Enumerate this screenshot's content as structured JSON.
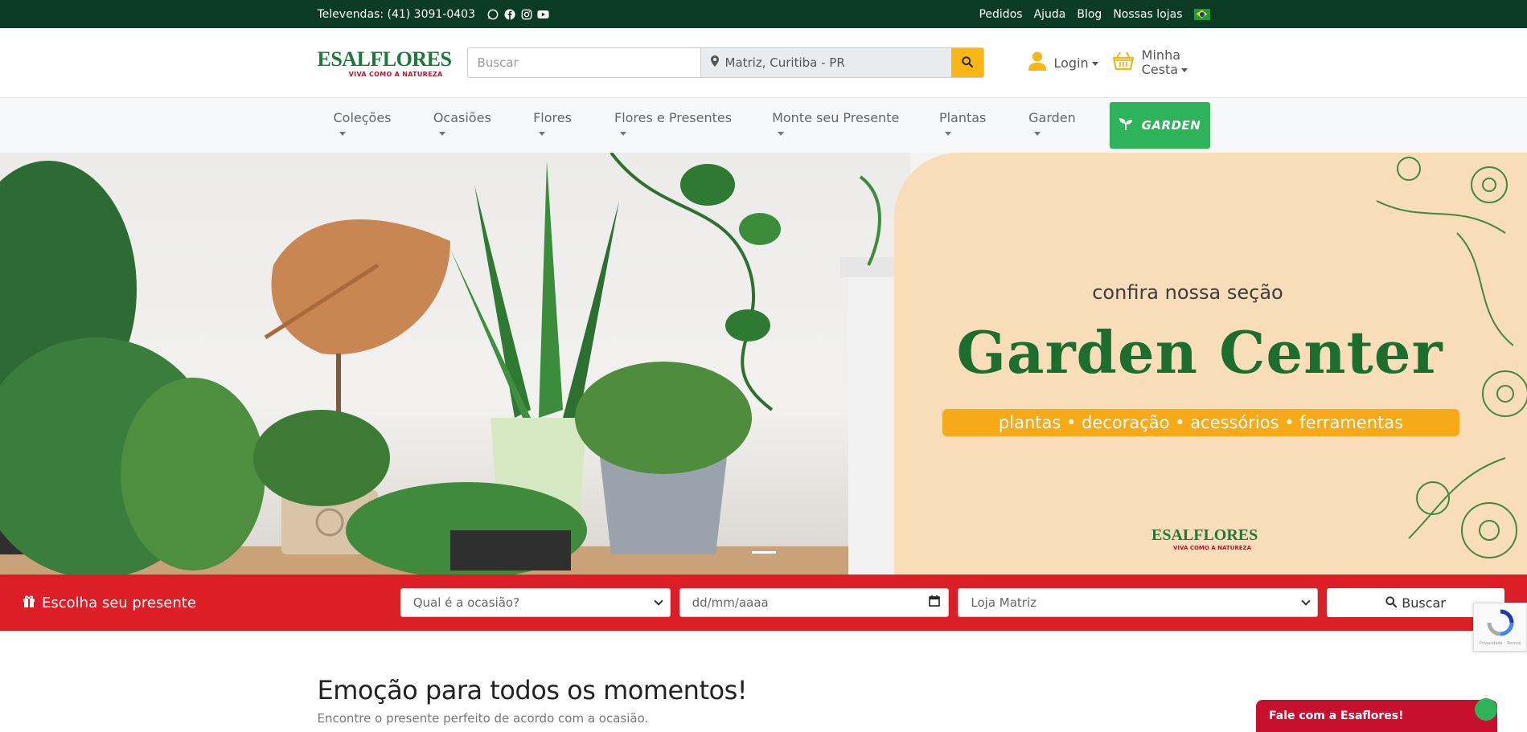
{
  "topbar": {
    "phone": "Televendas: (41) 3091-0403",
    "social_icons": [
      "whatsapp-icon",
      "facebook-icon",
      "instagram-icon",
      "youtube-icon"
    ],
    "links": [
      "Pedidos",
      "Ajuda",
      "Blog",
      "Nossas lojas"
    ]
  },
  "header": {
    "logo_brand": "ESALFLORES",
    "logo_tagline": "VIVA COMO A NATUREZA",
    "search_placeholder": "Buscar",
    "location": "Matriz, Curitiba - PR",
    "login_label": "Login",
    "cart_label_line1": "Minha",
    "cart_label_line2": "Cesta"
  },
  "nav": {
    "items": [
      "Coleções",
      "Ocasiões",
      "Flores",
      "Flores e Presentes",
      "Monte seu Presente",
      "Plantas",
      "Garden"
    ],
    "garden_button": "GARDEN"
  },
  "hero": {
    "subtitle": "confira nossa seção",
    "title": "Garden Center",
    "bar_text": "plantas • decoração • acessórios • ferramentas",
    "logo_brand": "ESALFLORES",
    "logo_tagline": "VIVA COMO A NATUREZA"
  },
  "giftbar": {
    "label": "Escolha seu presente",
    "occasion_placeholder": "Qual é a ocasião?",
    "date_placeholder": "dd/mm/aaaa",
    "store": "Loja Matriz",
    "search_button": "Buscar"
  },
  "recaptcha": {
    "label": "Privacidade - Termos"
  },
  "section": {
    "title": "Emoção para todos os momentos!",
    "subtitle": "Encontre o presente perfeito de acordo com a ocasião."
  },
  "chat": {
    "label": "Fale com a Esaflores!"
  },
  "colors": {
    "topbar": "#0c3b23",
    "brand_green": "#1b7a3a",
    "garden_button": "#2fb35a",
    "accent_yellow": "#f7b516",
    "gift_bar": "#dc1f26"
  }
}
